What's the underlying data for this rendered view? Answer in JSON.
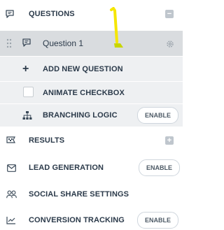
{
  "menu": {
    "questions": {
      "label": "QUESTIONS",
      "collapse_symbol": "−"
    },
    "question_item": {
      "label": "Question 1"
    },
    "add_question": {
      "label": "ADD NEW QUESTION",
      "symbol": "+"
    },
    "animate_checkbox": {
      "label": "ANIMATE CHECKBOX",
      "checked": false
    },
    "branching_logic": {
      "label": "BRANCHING LOGIC",
      "action": "ENABLE"
    },
    "results": {
      "label": "RESULTS",
      "expand_symbol": "+"
    },
    "lead_generation": {
      "label": "LEAD GENERATION",
      "action": "ENABLE"
    },
    "social_share": {
      "label": "SOCIAL SHARE SETTINGS"
    },
    "conversion_tracking": {
      "label": "CONVERSION TRACKING",
      "action": "ENABLE"
    }
  },
  "colors": {
    "text": "#2b3a4a",
    "submenu_bg": "#eef0f2",
    "selected_bg": "#d9dcdf",
    "annotation": "#f5e600"
  }
}
